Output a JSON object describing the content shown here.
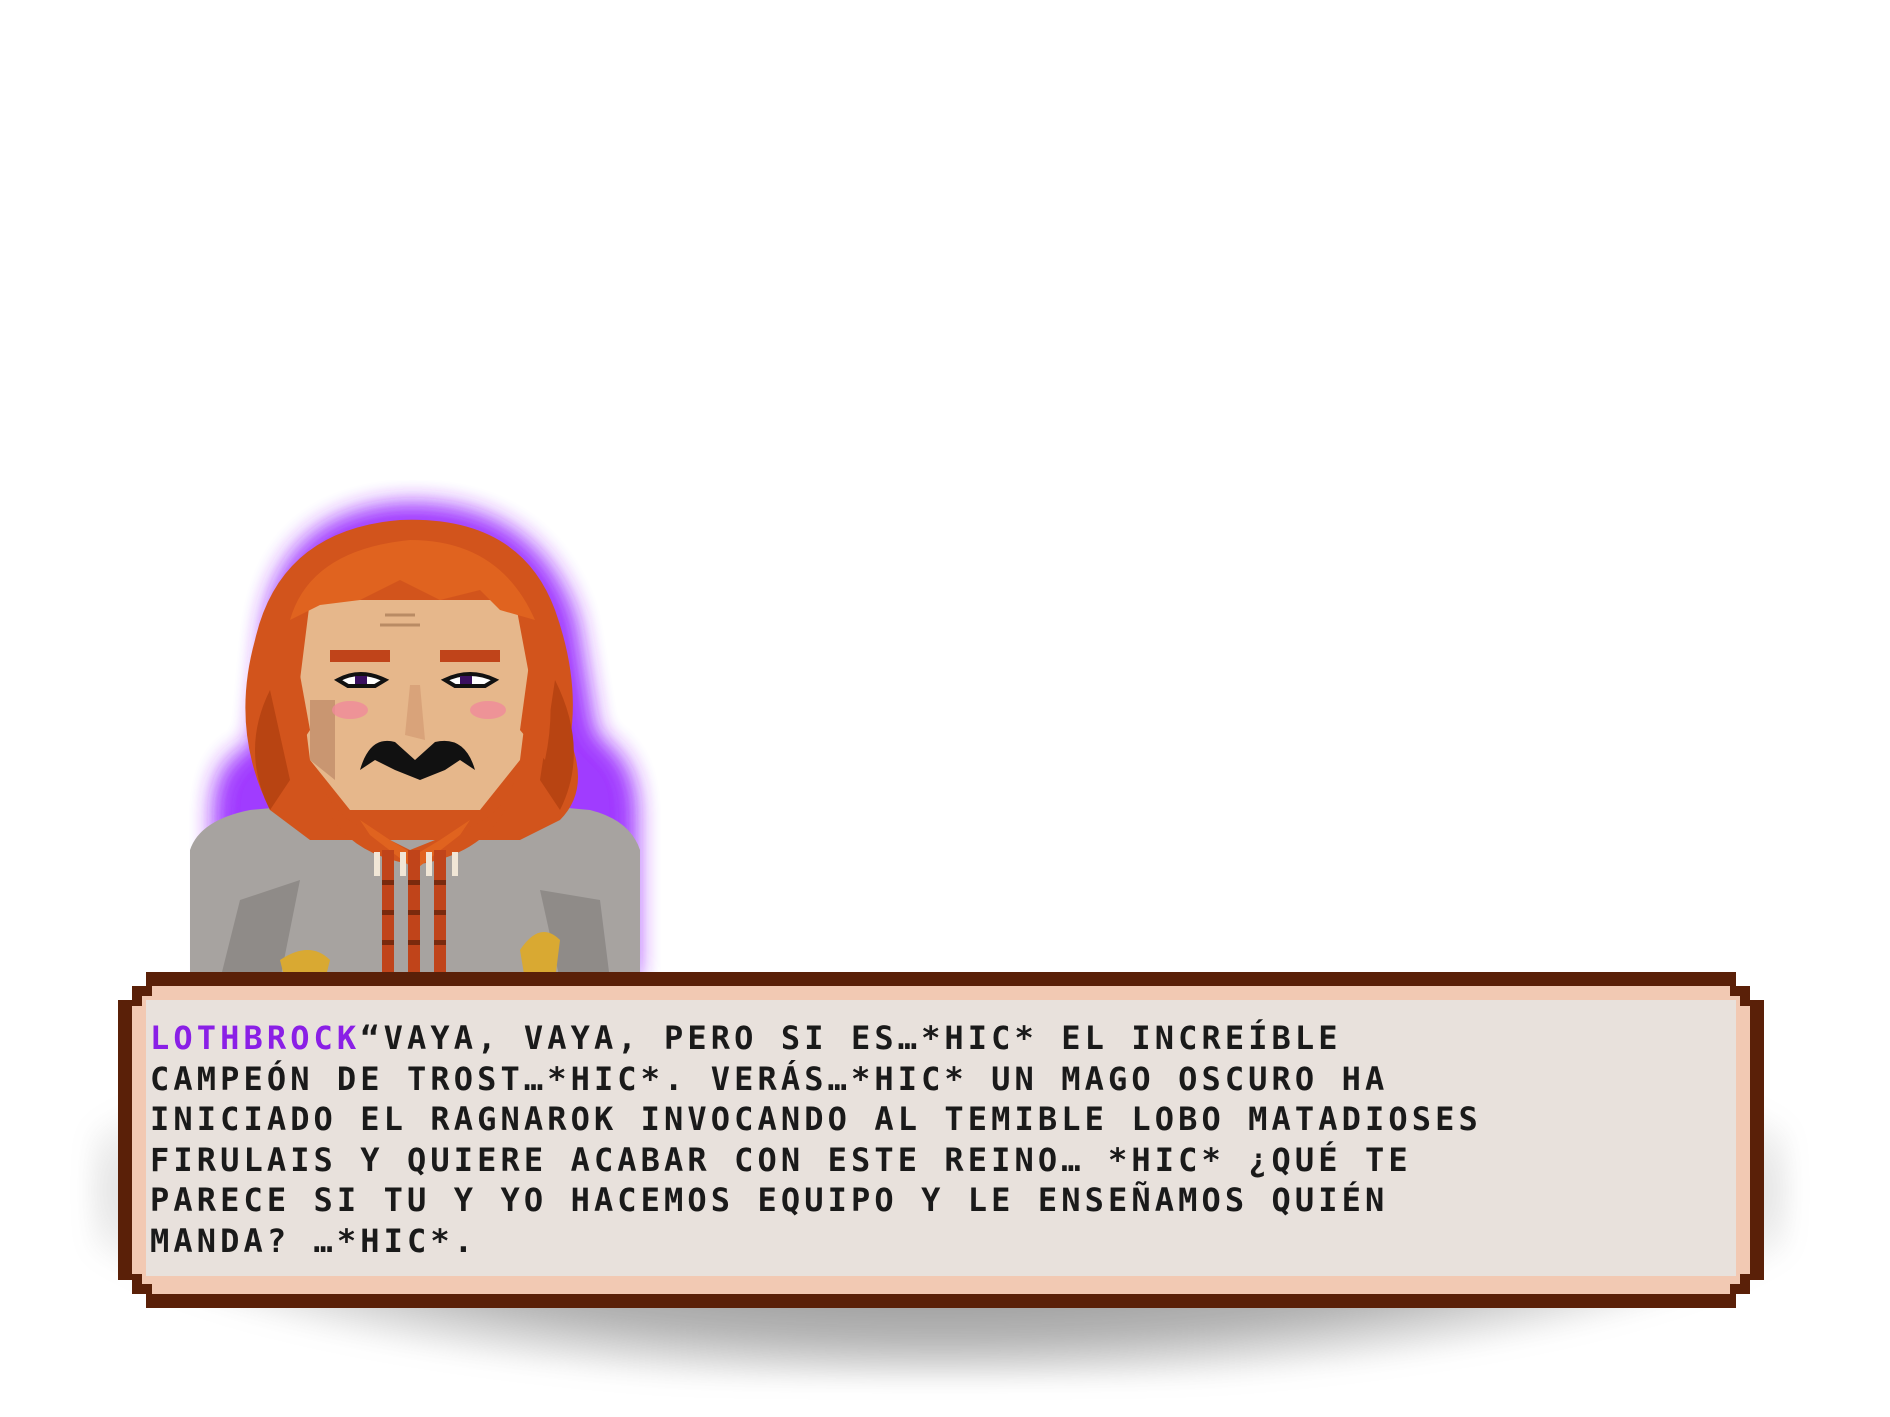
{
  "dialog": {
    "speaker": "LOTHBROCK",
    "lines": [
      "“VAYA, VAYA, PERO SI ES…*HIC* EL INCREÍBLE",
      "CAMPEÓN DE TROST…*HIC*. VERÁS…*HIC* UN MAGO OSCURO HA",
      "INICIADO EL RAGNAROK INVOCANDO AL TEMIBLE LOBO MATADIOSES",
      "FIRULAIS Y QUIERE ACABAR CON ESTE REINO… *HIC* ¿QUÉ TE",
      "PARECE SI TU Y YO HACEMOS EQUIPO Y LE ENSEÑAMOS QUIÉN",
      "MANDA? …*HIC*."
    ]
  },
  "portrait": {
    "character": "lothbrock-portrait",
    "glow_color": "#9b30ff",
    "hair_color": "#d2541c"
  },
  "colors": {
    "speaker": "#8a1fe6",
    "frame": "#5a2008",
    "frame_inner": "#f2c9b3",
    "paper": "#e8e1dc",
    "text": "#1a1a1a"
  }
}
